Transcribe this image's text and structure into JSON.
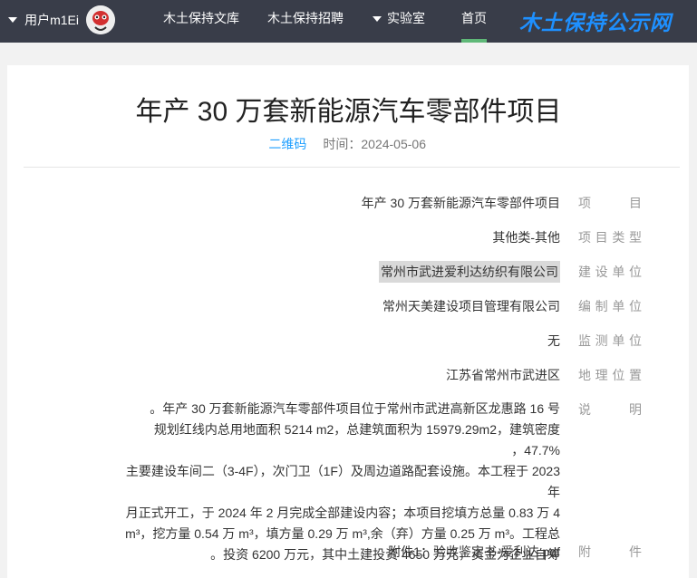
{
  "nav": {
    "logo": "木土保持公示网",
    "home": "首页",
    "lab": "实验室",
    "recruit": "木土保持招聘",
    "library": "木土保持文库",
    "user": "用户m1Ei"
  },
  "article": {
    "title": "年产 30 万套新能源汽车零部件项目",
    "time_label": "时间：",
    "time": "2024-05-06",
    "qr": "二维码"
  },
  "fields": [
    {
      "label": "项目",
      "value": "年产 30 万套新能源汽车零部件项目"
    },
    {
      "label": "项目类型",
      "value": "其他类-其他"
    },
    {
      "label": "建设单位",
      "value": "常州市武进爱利达纺织有限公司"
    },
    {
      "label": "编制单位",
      "value": "常州天美建设项目管理有限公司"
    },
    {
      "label": "监测单位",
      "value": "无"
    },
    {
      "label": "地理位置",
      "value": "江苏省常州市武进区"
    }
  ],
  "description": {
    "label": "说明",
    "lines": [
      "年产 30 万套新能源汽车零部件项目位于常州市武进高新区龙惠路 16 号。",
      "规划红线内总用地面积 5214 m2，总建筑面积为 15979.29m2，建筑密度 47.7%，",
      "主要建设车间二（3-4F），次门卫（1F）及周边道路配套设施。本工程于 2023 年",
      "4 月正式开工，于 2024 年 2 月完成全部建设内容；本项目挖填方总量 0.83 万",
      "m³，挖方量 0.54 万 m³，填方量 0.29 万 m³,余（弃）方量 0.25 万 m³。工程总",
      "投资 6200 万元，其中土建投资 4650 万元，资金为企业自筹。"
    ]
  },
  "attachment": {
    "label": "附件",
    "value": "附件1：验收鉴定书-爱利达.pdf"
  }
}
